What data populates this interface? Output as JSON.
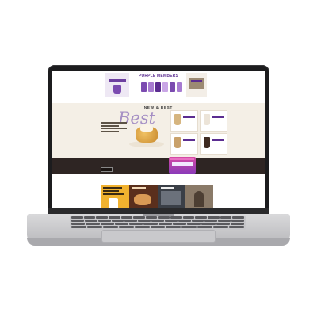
{
  "promo": {
    "title": "PURPLE MEMBERS",
    "pill_colors": [
      "#7b4bb0",
      "#a77bd1",
      "#5b2d91",
      "#c9a6e6",
      "#7b4bb0",
      "#a77bd1"
    ]
  },
  "hero": {
    "section_label": "NEW & BEST",
    "headline": "Best",
    "products": [
      {
        "glass_color": "#d6b57f"
      },
      {
        "glass_color": "#ece4d8"
      },
      {
        "glass_color": "#c9a16a"
      },
      {
        "glass_color": "#3e2a20"
      }
    ]
  },
  "colors": {
    "brand_purple": "#5b2d91",
    "hero_bg": "#f4efe6",
    "banner_bg": "#2e2523",
    "laptop_frame": "#1c1c1e",
    "laptop_base": "#c6c6c9"
  },
  "icons": [
    "laptop-icon"
  ]
}
